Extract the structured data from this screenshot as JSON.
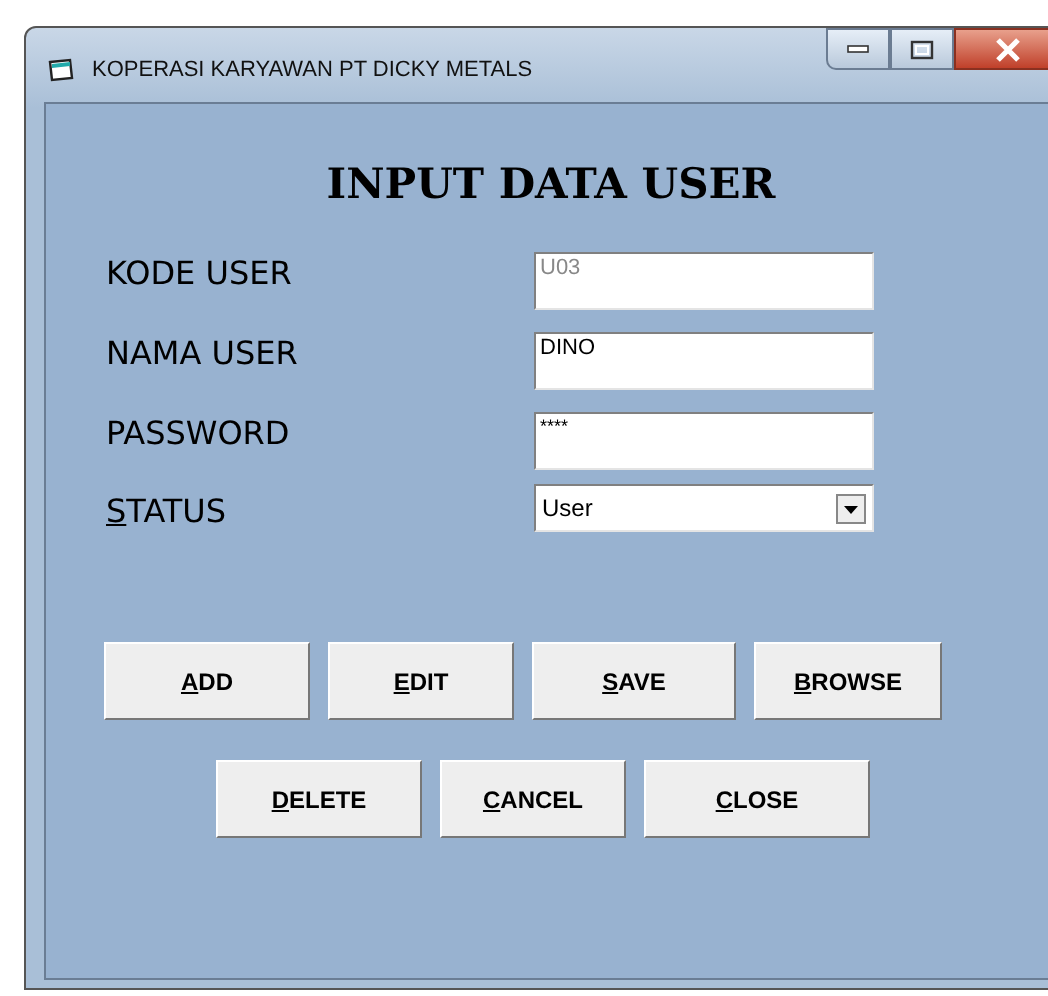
{
  "window": {
    "title": "KOPERASI KARYAWAN PT DICKY METALS"
  },
  "heading": "INPUT DATA USER",
  "fields": [
    {
      "kind": "text",
      "label": "KODE USER",
      "value": "U03",
      "disabled": true
    },
    {
      "kind": "text",
      "label": "NAMA USER",
      "value": "DINO",
      "disabled": false
    },
    {
      "kind": "text",
      "label": "PASSWORD",
      "value": "****",
      "disabled": false
    },
    {
      "kind": "dropdown",
      "mnemonic": "S",
      "label": "TATUS",
      "value": "User",
      "disabled": false
    }
  ],
  "button_rows": [
    [
      {
        "mnemonic": "A",
        "rest": "DD"
      },
      {
        "mnemonic": "E",
        "rest": "DIT"
      },
      {
        "mnemonic": "S",
        "rest": "AVE"
      },
      {
        "mnemonic": "B",
        "rest": "ROWSE"
      }
    ],
    [
      {
        "mnemonic": "D",
        "rest": "ELETE"
      },
      {
        "mnemonic": "C",
        "rest": "ANCEL"
      },
      {
        "mnemonic": "C",
        "rest": "LOSE"
      }
    ]
  ]
}
